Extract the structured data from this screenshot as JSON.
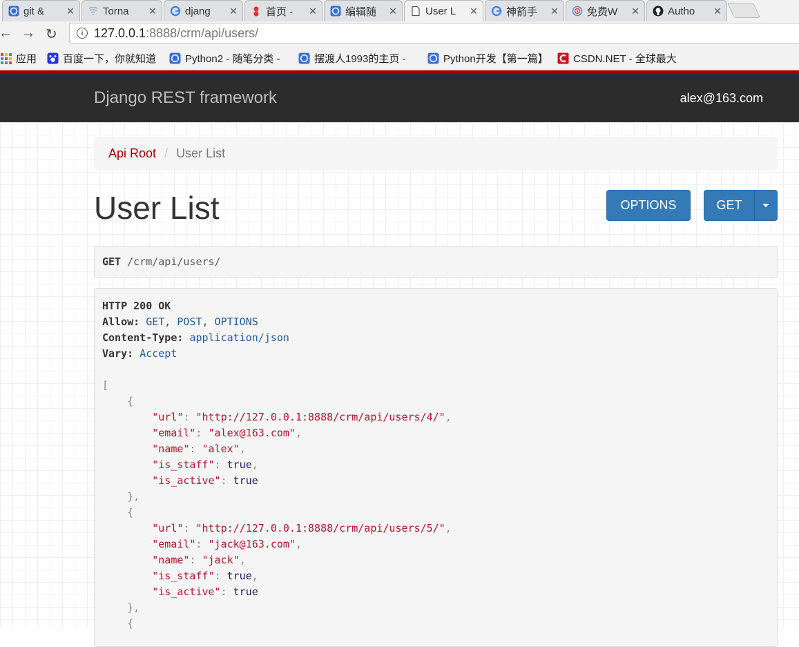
{
  "browser": {
    "tabs": [
      {
        "title": "git &",
        "icon": "cnblogs-icon",
        "active": false
      },
      {
        "title": "Torna",
        "icon": "tornado-icon",
        "active": false
      },
      {
        "title": "djang",
        "icon": "google-icon",
        "active": false
      },
      {
        "title": "首页 -",
        "icon": "pin-icon",
        "active": false
      },
      {
        "title": "编辑随",
        "icon": "cnblogs-icon",
        "active": false
      },
      {
        "title": "User L",
        "icon": "page-icon",
        "active": true
      },
      {
        "title": "神箭手",
        "icon": "google-icon",
        "active": false
      },
      {
        "title": "免费W",
        "icon": "target-icon",
        "active": false
      },
      {
        "title": "Autho",
        "icon": "github-icon",
        "active": false
      }
    ],
    "url_host": "127.0.0.1",
    "url_rest": ":8888/crm/api/users/",
    "bookmarks": [
      {
        "label": "应用",
        "icon": "apps-icon"
      },
      {
        "label": "百度一下，你就知道",
        "icon": "baidu-icon"
      },
      {
        "label": "Python2 - 随笔分类 -",
        "icon": "cnblogs-icon"
      },
      {
        "label": "摆渡人1993的主页 - ",
        "icon": "cnblogs-icon"
      },
      {
        "label": "Python开发【第一篇】",
        "icon": "cnblogs-icon"
      },
      {
        "label": "CSDN.NET - 全球最大",
        "icon": "csdn-icon"
      }
    ]
  },
  "navbar": {
    "brand": "Django REST framework",
    "user": "alex@163.com"
  },
  "breadcrumb": {
    "root": "Api Root",
    "separator": "/",
    "current": "User List"
  },
  "page": {
    "title": "User List",
    "options_label": "OPTIONS",
    "get_label": "GET"
  },
  "request": {
    "method": "GET",
    "path": "/crm/api/users/"
  },
  "response": {
    "status": "HTTP 200 OK",
    "headers": [
      {
        "name": "Allow:",
        "value": "GET, POST, OPTIONS"
      },
      {
        "name": "Content-Type:",
        "value": "application/json"
      },
      {
        "name": "Vary:",
        "value": "Accept"
      }
    ],
    "users": [
      {
        "url": "\"http://127.0.0.1:8888/crm/api/users/4/\"",
        "email": "\"alex@163.com\"",
        "name": "\"alex\"",
        "is_staff": "true",
        "is_active": "true"
      },
      {
        "url": "\"http://127.0.0.1:8888/crm/api/users/5/\"",
        "email": "\"jack@163.com\"",
        "name": "\"jack\"",
        "is_staff": "true",
        "is_active": "true"
      }
    ],
    "keys": {
      "url": "\"url\"",
      "email": "\"email\"",
      "name": "\"name\"",
      "is_staff": "\"is_staff\"",
      "is_active": "\"is_active\""
    }
  },
  "colors": {
    "accent_red": "#a30000",
    "button_blue": "#337ab7",
    "navbar": "#2c2c2c"
  }
}
